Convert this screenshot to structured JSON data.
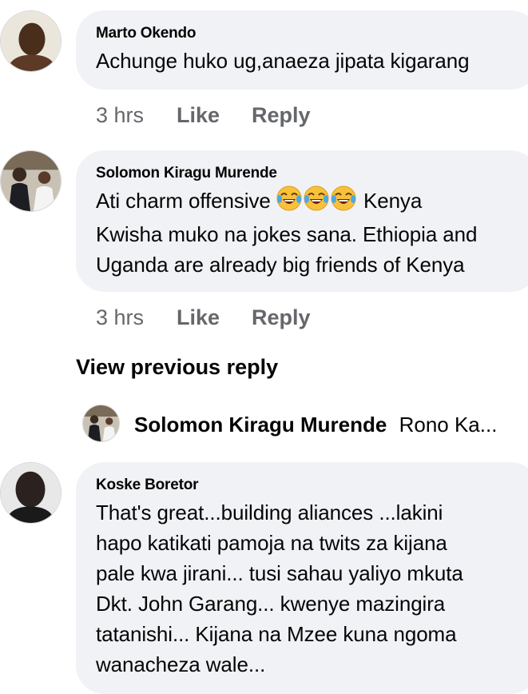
{
  "comments": [
    {
      "author": "Marto Okendo",
      "text": "Achunge huko ug,anaeza jipata kigarang",
      "time": "3 hrs",
      "like_label": "Like",
      "reply_label": "Reply",
      "avatar_icon": "user-photo-avatar"
    },
    {
      "author": "Solomon Kiragu Murende",
      "text_line1_before": "Ati charm offensive ",
      "emojis": [
        "face-with-tears-of-joy",
        "face-with-tears-of-joy",
        "face-with-tears-of-joy"
      ],
      "text_line1_after": " Kenya",
      "text_line2": "Kwisha muko na jokes sana. Ethiopia and",
      "text_line3": "Uganda are already big friends of Kenya",
      "time": "3 hrs",
      "like_label": "Like",
      "reply_label": "Reply",
      "avatar_icon": "user-photo-avatar"
    },
    {
      "author": "Koske Boretor",
      "lines": [
        "That's great...building aliances ...lakini",
        "hapo katikati pamoja na twits za kijana",
        "pale kwa jirani... tusi sahau yaliyo mkuta",
        "Dkt. John Garang... kwenye mazingira",
        "tatanishi... Kijana na Mzee kuna ngoma",
        "wanacheza wale..."
      ],
      "avatar_icon": "user-photo-avatar"
    }
  ],
  "view_previous_reply": "View previous reply",
  "reply_preview": {
    "author": "Solomon Kiragu Murende",
    "snippet": "Rono Ka..."
  },
  "colors": {
    "bubble": "#f0f2f5",
    "meta_text": "#65676b",
    "primary_text": "#050505"
  }
}
